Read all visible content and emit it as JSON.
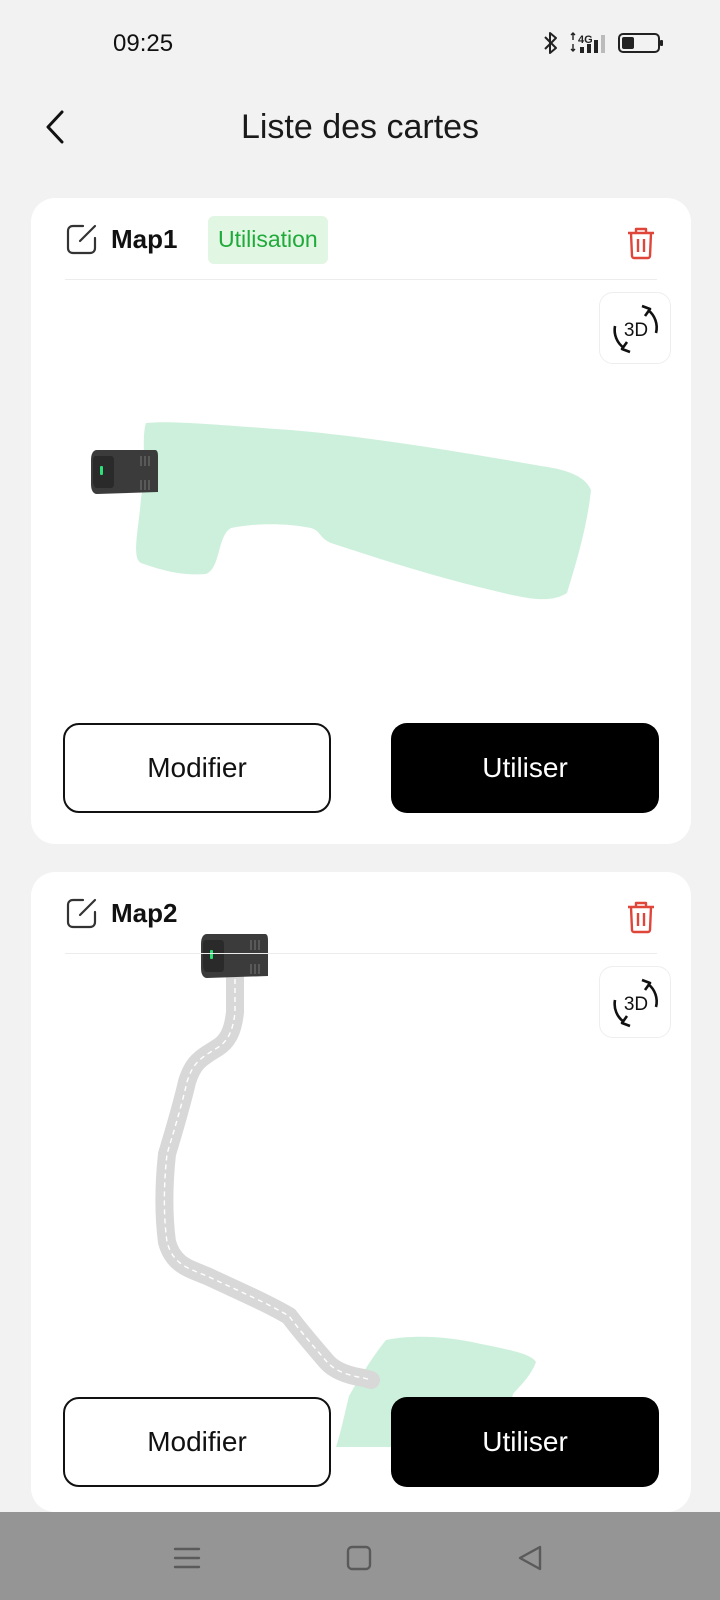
{
  "status_bar": {
    "time": "09:25",
    "icons": [
      "bluetooth-icon",
      "network-4g-icon",
      "signal-icon",
      "battery-icon"
    ],
    "network_label": "4G"
  },
  "header": {
    "title": "Liste des cartes",
    "back_icon": "chevron-left-icon"
  },
  "maps": [
    {
      "name": "Map1",
      "badge": "Utilisation",
      "view_3d_label": "3D",
      "edit_label": "Modifier",
      "use_label": "Utiliser"
    },
    {
      "name": "Map2",
      "view_3d_label": "3D",
      "edit_label": "Modifier",
      "use_label": "Utiliser"
    }
  ],
  "colors": {
    "accent_green": "#1faa3a",
    "badge_bg": "#e2f7e3",
    "lawn_fill": "#cdf0dc",
    "delete_red": "#e0453a",
    "primary_button": "#000000",
    "path_gray": "#dcdcdc"
  },
  "nav_bar": {
    "icons": [
      "menu-icon",
      "home-square-icon",
      "back-triangle-icon"
    ]
  }
}
